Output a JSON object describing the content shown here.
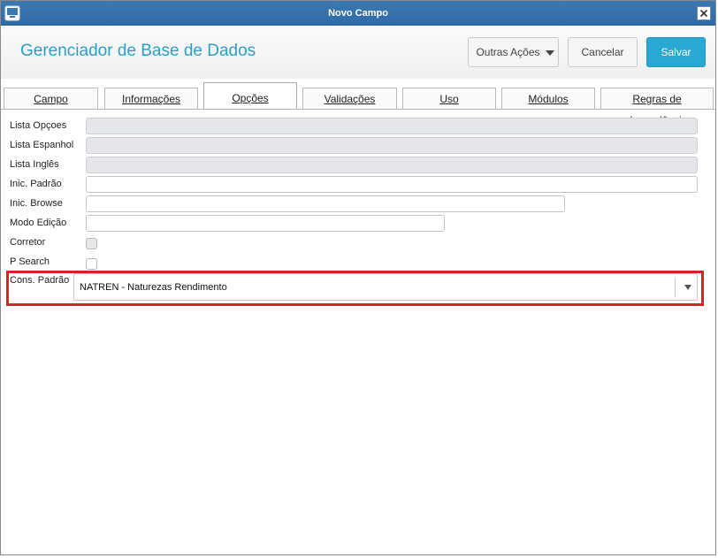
{
  "window": {
    "title": "Novo Campo"
  },
  "header": {
    "app_title": "Gerenciador de Base de Dados",
    "buttons": {
      "outras_acoes": "Outras Ações",
      "cancelar": "Cancelar",
      "salvar": "Salvar"
    }
  },
  "tabs": [
    {
      "label": "Campo"
    },
    {
      "label": "Informações"
    },
    {
      "label": "Opções",
      "active": true
    },
    {
      "label": "Validações"
    },
    {
      "label": "Uso"
    },
    {
      "label": "Módulos"
    },
    {
      "label": "Regras de dependência"
    }
  ],
  "form": {
    "lista_opcoes": {
      "label": "Lista Opçoes",
      "value": ""
    },
    "lista_espanhol": {
      "label": "Lista Espanhol",
      "value": ""
    },
    "lista_ingles": {
      "label": "Lista Inglês",
      "value": ""
    },
    "inic_padrao": {
      "label": "Inic. Padrão",
      "value": ""
    },
    "inic_browse": {
      "label": "Inic. Browse",
      "value": ""
    },
    "modo_edicao": {
      "label": "Modo Edição",
      "value": ""
    },
    "corretor": {
      "label": "Corretor",
      "checked": false
    },
    "p_search": {
      "label": "P Search",
      "checked": false
    },
    "cons_padrao": {
      "label": "Cons. Padrão",
      "value": "NATREN - Naturezas Rendimento"
    }
  },
  "colors": {
    "titlebar": "#2e6aa6",
    "accent": "#2aa8d4",
    "app_title": "#2c9fc4",
    "highlight": "#dd1f26"
  }
}
